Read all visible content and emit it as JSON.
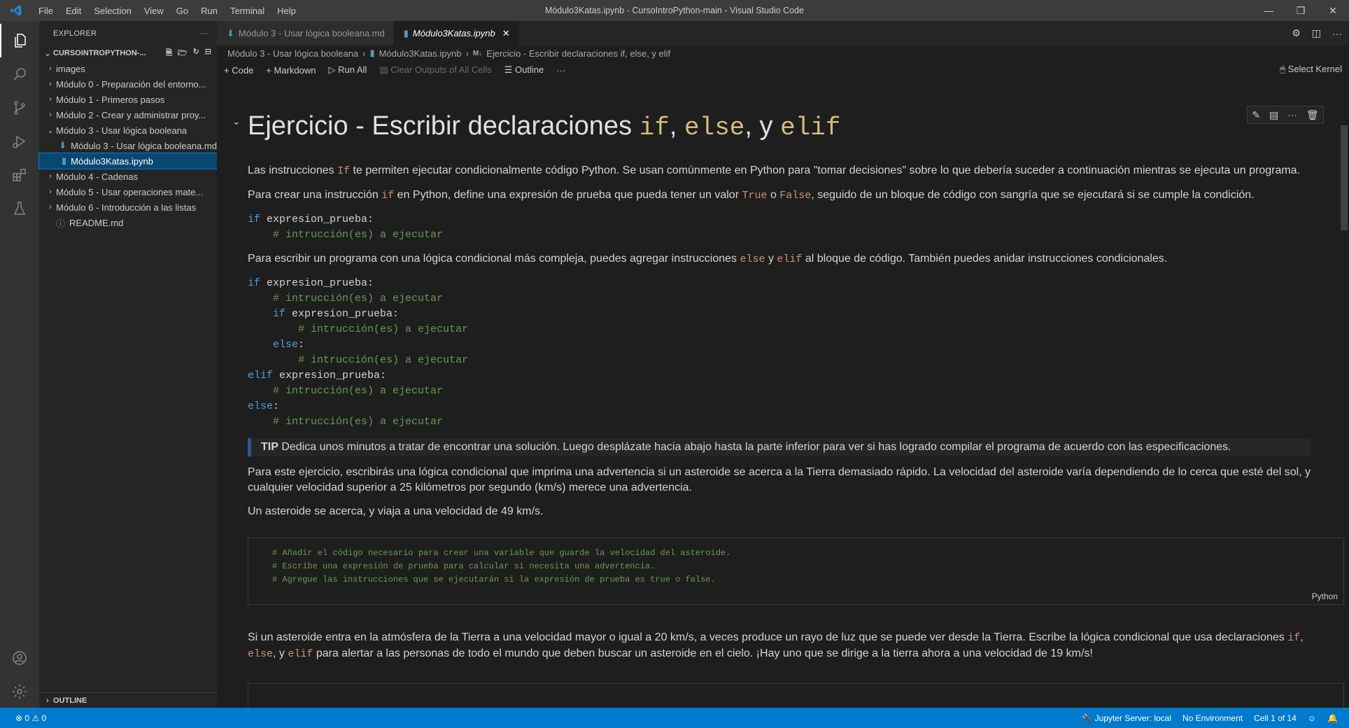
{
  "window": {
    "title": "Módulo3Katas.ipynb - CursoIntroPython-main - Visual Studio Code",
    "menu": [
      "File",
      "Edit",
      "Selection",
      "View",
      "Go",
      "Run",
      "Terminal",
      "Help"
    ]
  },
  "sidebar": {
    "header": "EXPLORER",
    "root": "CURSOINTROPYTHON-...",
    "items": [
      {
        "label": "images",
        "indent": 1,
        "twisty": "›",
        "icon": ""
      },
      {
        "label": "Módulo 0 - Preparación del entorno...",
        "indent": 1,
        "twisty": "›",
        "icon": ""
      },
      {
        "label": "Módulo 1 - Primeros pasos",
        "indent": 1,
        "twisty": "›",
        "icon": ""
      },
      {
        "label": "Módulo 2 - Crear y administrar proy...",
        "indent": 1,
        "twisty": "›",
        "icon": ""
      },
      {
        "label": "Módulo 3 - Usar lógica booleana",
        "indent": 1,
        "twisty": "⌄",
        "icon": ""
      },
      {
        "label": "Módulo 3 - Usar lógica booleana.md",
        "indent": 2,
        "twisty": "",
        "icon": "md"
      },
      {
        "label": "Módulo3Katas.ipynb",
        "indent": 2,
        "twisty": "",
        "icon": "nb",
        "selected": true
      },
      {
        "label": "Módulo 4 - Cadenas",
        "indent": 1,
        "twisty": "›",
        "icon": ""
      },
      {
        "label": "Módulo 5 - Usar operaciones mate...",
        "indent": 1,
        "twisty": "›",
        "icon": ""
      },
      {
        "label": "Módulo 6 - Introducción a las listas",
        "indent": 1,
        "twisty": "›",
        "icon": ""
      },
      {
        "label": "README.md",
        "indent": 1,
        "twisty": "",
        "icon": "info"
      }
    ],
    "outline": "OUTLINE"
  },
  "tabs": [
    {
      "label": "Módulo 3 - Usar lógica booleana.md",
      "active": false
    },
    {
      "label": "Módulo3Katas.ipynb",
      "active": true
    }
  ],
  "breadcrumbs": {
    "part1": "Módulo 3 - Usar lógica booleana",
    "part2": "Módulo3Katas.ipynb",
    "part3_prefix": "M↓",
    "part3": "Ejercicio - Escribir declaraciones if, else, y elif"
  },
  "toolbar": {
    "code": "Code",
    "markdown": "Markdown",
    "run_all": "Run All",
    "clear_outputs": "Clear Outputs of All Cells",
    "outline": "Outline",
    "more": "···",
    "select_kernel": "Select Kernel"
  },
  "content": {
    "h1_text": "Ejercicio - Escribir declaraciones ",
    "h1_if": "if",
    "h1_sep1": ", ",
    "h1_else": "else",
    "h1_sep2": ", y ",
    "h1_elif": "elif",
    "p1_a": "Las instrucciones ",
    "p1_code": "If",
    "p1_b": " te permiten ejecutar condicionalmente código Python. Se usan comúnmente en Python para \"tomar decisiones\" sobre lo que debería suceder a continuación mientras se ejecuta un programa.",
    "p2_a": "Para crear una instrucción ",
    "p2_code1": "if",
    "p2_b": " en Python, define una expresión de prueba que pueda tener un valor ",
    "p2_code2": "True",
    "p2_c": " o ",
    "p2_code3": "False",
    "p2_d": ", seguido de un bloque de código con sangría que se ejecutará si se cumple la condición.",
    "code1_l1_kw": "if",
    "code1_l1_rest": " expresion_prueba:",
    "code1_l2": "    # intrucción(es) a ejecutar",
    "p3_a": "Para escribir un programa con una lógica condicional más compleja, puedes agregar instrucciones ",
    "p3_code1": "else",
    "p3_b": " y ",
    "p3_code2": "elif",
    "p3_c": " al bloque de código. También puedes anidar instrucciones condicionales.",
    "code2": [
      {
        "indent": "",
        "kw": "if",
        "rest": " expresion_prueba:",
        "comment": ""
      },
      {
        "indent": "    ",
        "kw": "",
        "rest": "",
        "comment": "# intrucción(es) a ejecutar"
      },
      {
        "indent": "    ",
        "kw": "if",
        "rest": " expresion_prueba:",
        "comment": ""
      },
      {
        "indent": "        ",
        "kw": "",
        "rest": "",
        "comment": "# intrucción(es) a ejecutar"
      },
      {
        "indent": "    ",
        "kw": "else",
        "rest": ":",
        "comment": ""
      },
      {
        "indent": "        ",
        "kw": "",
        "rest": "",
        "comment": "# intrucción(es) a ejecutar"
      },
      {
        "indent": "",
        "kw": "elif",
        "rest": " expresion_prueba:",
        "comment": ""
      },
      {
        "indent": "    ",
        "kw": "",
        "rest": "",
        "comment": "# intrucción(es) a ejecutar"
      },
      {
        "indent": "",
        "kw": "else",
        "rest": ":",
        "comment": ""
      },
      {
        "indent": "    ",
        "kw": "",
        "rest": "",
        "comment": "# intrucción(es) a ejecutar"
      }
    ],
    "tip_label": "TIP",
    "tip_text": " Dedica unos minutos a tratar de encontrar una solución. Luego desplázate hacia abajo hasta la parte inferior para ver si has logrado compilar el programa de acuerdo con las especificaciones.",
    "p4": "Para este ejercicio, escribirás una lógica condicional que imprima una advertencia si un asteroide se acerca a la Tierra demasiado rápido. La velocidad del asteroide varía dependiendo de lo cerca que esté del sol, y cualquier velocidad superior a 25 kilómetros por segundo (km/s) merece una advertencia.",
    "p5": "Un asteroide se acerca, y viaja a una velocidad de 49 km/s.",
    "cell_lines": [
      "# Añadir el código necesario para crear una variable que guarde la velocidad del asteroide.",
      "# Escribe una expresión de prueba para calcular si necesita una advertencia.",
      "# Agregue las instrucciones que se ejecutarán si la expresión de prueba es true o false."
    ],
    "cell_lang": "Python",
    "p6_a": "Si un asteroide entra en la atmósfera de la Tierra a una velocidad mayor o igual a 20 km/s, a veces produce un rayo de luz que se puede ver desde la Tierra. Escribe la lógica condicional que usa declaraciones ",
    "p6_code1": "if",
    "p6_b": ", ",
    "p6_code2": "else",
    "p6_c": ", y ",
    "p6_code3": "elif",
    "p6_d": " para alertar a las personas de todo el mundo que deben buscar un asteroide en el cielo. ¡Hay uno que se dirige a la tierra ahora a una velocidad de 19 km/s!"
  },
  "statusbar": {
    "errors": "0",
    "warnings": "0",
    "jupyter": "Jupyter Server: local",
    "environment": "No Environment",
    "cell": "Cell 1 of 14"
  }
}
